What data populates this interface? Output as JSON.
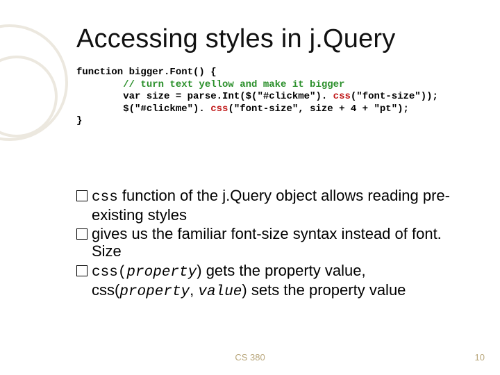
{
  "title": "Accessing styles in j.Query",
  "code": {
    "l1a": "function",
    "l1b": " bigger.Font() {",
    "l2": "        // turn text yellow and make it bigger",
    "l3a": "        var",
    "l3b": " size = parse.Int($(\"#clickme\"). ",
    "l3c": "css",
    "l3d": "(\"font-size\"));",
    "l4a": "        $(\"#clickme\"). ",
    "l4b": "css",
    "l4c": "(\"font-size\", size + 4 + \"pt\");",
    "l5": "}"
  },
  "bullets": {
    "b1_pre": "css",
    "b1_rest": " function of the j.Query object allows reading pre-existing styles",
    "b2_pre": "gives",
    "b2_rest": " us the familiar font-size syntax instead of font. Size",
    "b3_pre": "css(",
    "b3_prop1": "property",
    "b3_mid1": ") gets the property value, css(",
    "b3_prop2": "property",
    "b3_sep": ", ",
    "b3_val": "value",
    "b3_mid2": ") sets the property value"
  },
  "footer": {
    "center": "CS 380",
    "page": "10"
  }
}
